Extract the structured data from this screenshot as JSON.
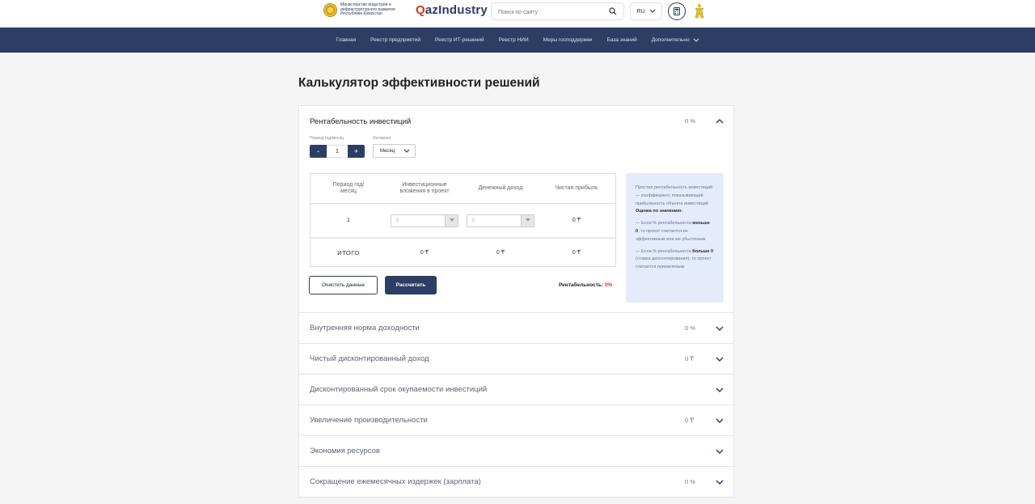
{
  "header": {
    "ministry": "Министерство индустрии и инфраструктурного развития Республики Казахстан",
    "logo_q": "Q",
    "logo_rest": "azIndustry",
    "search_placeholder": "Поиск по сайту",
    "lang": "RU"
  },
  "nav": [
    "Главная",
    "Реестр предприятий",
    "Реестр ИТ-решений",
    "Реестр НИИ",
    "Меры господдержки",
    "База знаний",
    "Дополнительно"
  ],
  "page_title": "Калькулятор эффективности решений",
  "roi": {
    "title": "Рентабельность инвестиций",
    "value": "0 %",
    "period_label": "Период год/месяц",
    "interval_label": "Интервал",
    "minus": "-",
    "plus": "+",
    "period_value": "1",
    "interval_value": "Месяц",
    "columns": [
      "Период год/месяц",
      "Инвестиционные вложения в проект",
      "Денежный доход",
      "Чистая прибыль"
    ],
    "row": {
      "period": "1",
      "invest": "0",
      "income": "0",
      "profit": "0 ₸"
    },
    "total": {
      "label": "ИТОГО",
      "invest": "0 ₸",
      "income": "0 ₸",
      "profit": "0 ₸"
    },
    "clear_btn": "Очистить данные",
    "calc_btn": "Рассчитать",
    "result_label": "Рентабельность:",
    "result_value": "0%",
    "info": {
      "p1": "Простая рентабельность инвестиций — коэффициент, показывающий прибыльность объекта инвестиций",
      "p2_bold": "Оценка по значению:",
      "p3_a": "— Если % рентабельности",
      "p3_b": "меньше 0",
      "p3_c": ", то проект считается не эффективным или же убыточным",
      "p4_a": "— Если % рентабельности",
      "p4_b": "больше 0",
      "p4_c": " (ставка дисконтирования), то проект считается приемлемым"
    }
  },
  "sections": [
    {
      "title": "Внутренняя норма доходности",
      "value": "0 %"
    },
    {
      "title": "Чистый дисконтированный доход",
      "value": "0 ₸"
    },
    {
      "title": "Дисконтированный срок окупаемости инвестиций",
      "value": ""
    },
    {
      "title": "Увеличение производительности",
      "value": "0 ₸"
    },
    {
      "title": "Экономия ресурсов",
      "value": ""
    },
    {
      "title": "Сокращение ежемесячных издержек (зарплата)",
      "value": "0 %"
    }
  ]
}
